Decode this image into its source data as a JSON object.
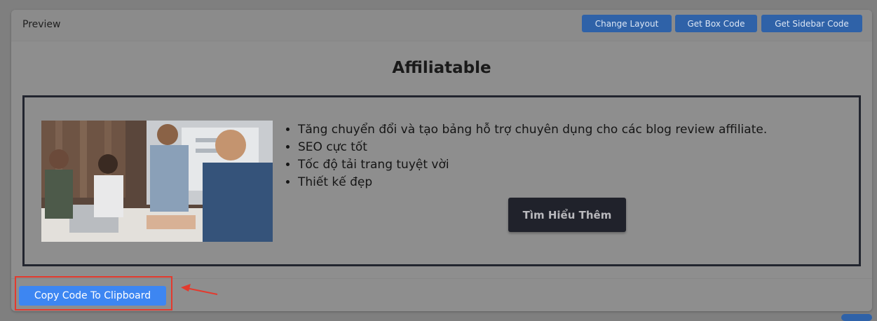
{
  "header": {
    "title": "Preview",
    "buttons": {
      "change_layout": "Change Layout",
      "get_box_code": "Get Box Code",
      "get_sidebar_code": "Get Sidebar Code"
    }
  },
  "preview_box": {
    "title": "Affiliatable",
    "image_alt": "team-meeting-photo",
    "features": [
      "Tăng chuyển đổi và tạo bảng hỗ trợ chuyên dụng cho các blog review affiliate.",
      "SEO cực tốt",
      "Tốc độ tải trang tuyệt vời",
      "Thiết kế đẹp"
    ],
    "cta_label": "Tìm Hiểu Thêm"
  },
  "footer": {
    "copy_button": "Copy Code To Clipboard"
  },
  "colors": {
    "primary_button": "#3d86f2",
    "header_button": "#2f62a8",
    "cta_button": "#20222b",
    "highlight": "#e33a2e"
  }
}
